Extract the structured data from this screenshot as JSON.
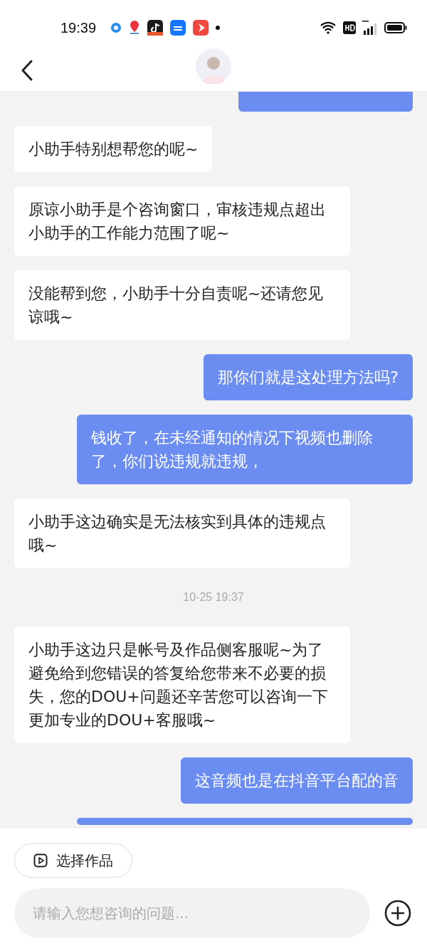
{
  "status_bar": {
    "time": "19:39"
  },
  "messages": [
    {
      "kind": "partial_top",
      "outgoing": true
    },
    {
      "kind": "text",
      "outgoing": false,
      "text": "小助手特别想帮您的呢~"
    },
    {
      "kind": "text",
      "outgoing": false,
      "text": "原谅小助手是个咨询窗口，审核违规点超出小助手的工作能力范围了呢~"
    },
    {
      "kind": "text",
      "outgoing": false,
      "text": "没能帮到您，小助手十分自责呢~还请您见谅哦~"
    },
    {
      "kind": "text",
      "outgoing": true,
      "text": "那你们就是这处理方法吗?"
    },
    {
      "kind": "text",
      "outgoing": true,
      "text": "钱收了，在未经通知的情况下视频也删除了，你们说违规就违规，"
    },
    {
      "kind": "text",
      "outgoing": false,
      "text": "小助手这边确实是无法核实到具体的违规点哦~"
    },
    {
      "kind": "time",
      "text": "10-25 19:37"
    },
    {
      "kind": "text",
      "outgoing": false,
      "text": "小助手这边只是帐号及作品侧客服呢~为了避免给到您错误的答复给您带来不必要的损失，您的DOU+问题还辛苦您可以咨询一下更加专业的DOU+客服哦~"
    },
    {
      "kind": "text",
      "outgoing": true,
      "text": "这音频也是在抖音平台配的音"
    },
    {
      "kind": "partial_bottom",
      "outgoing": true
    }
  ],
  "select_button": {
    "label": "选择作品"
  },
  "input": {
    "placeholder": "请输入您想咨询的问题..."
  }
}
